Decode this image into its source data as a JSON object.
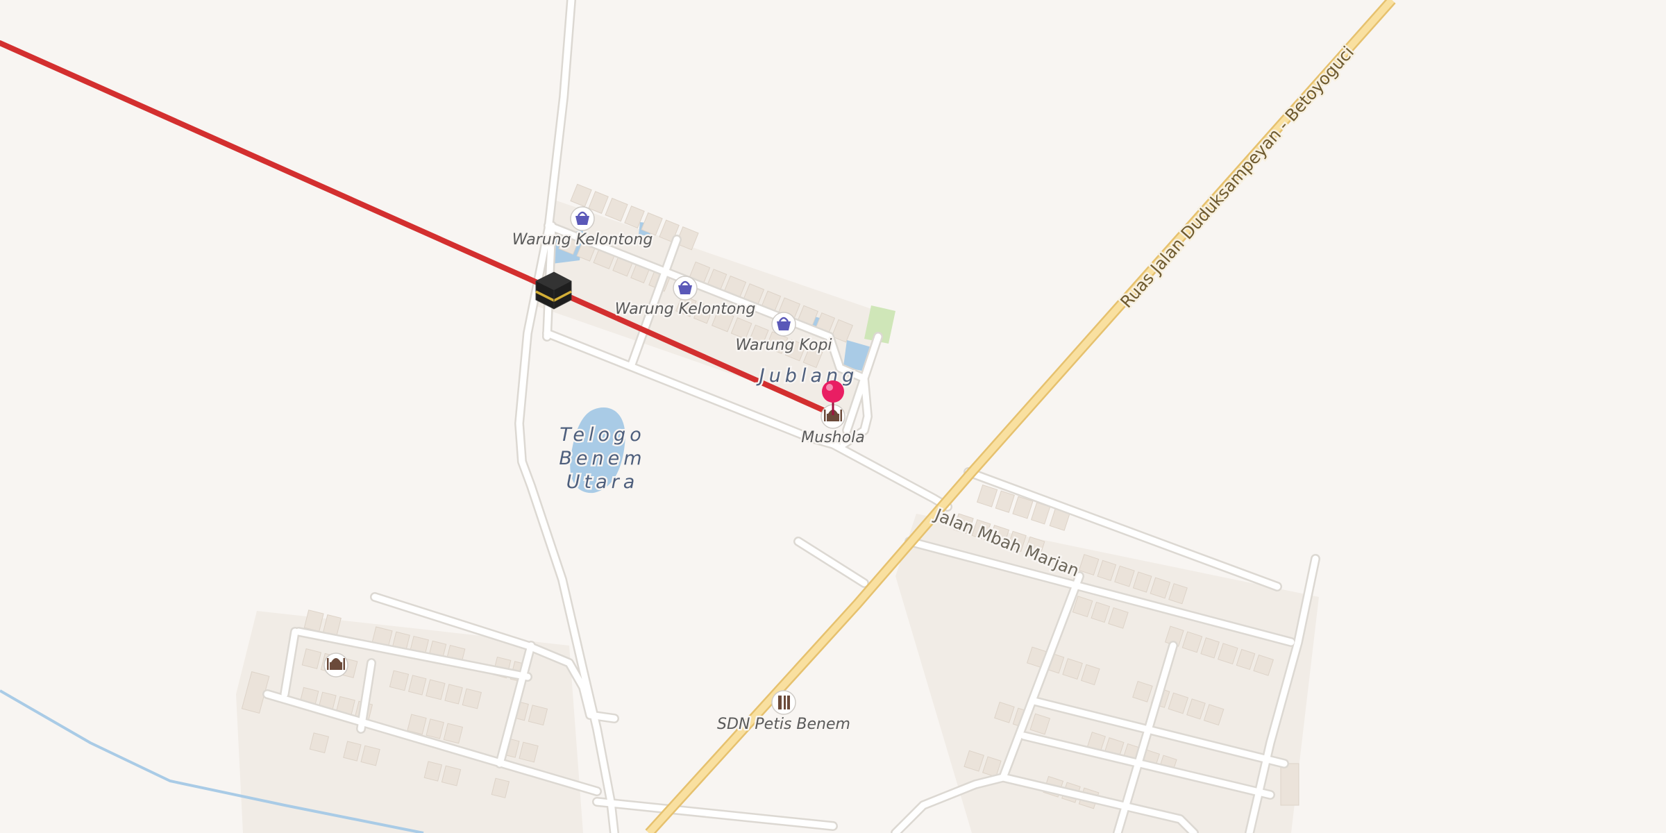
{
  "map": {
    "places": [
      {
        "id": "jublang",
        "lines": [
          "Jublang"
        ]
      },
      {
        "id": "telogo",
        "lines": [
          "Telogo",
          "Benem",
          "Utara"
        ]
      }
    ],
    "pois": [
      {
        "id": "warung-kelontong-1",
        "label": "Warung Kelontong",
        "icon": "shopping-basket-icon"
      },
      {
        "id": "warung-kelontong-2",
        "label": "Warung Kelontong",
        "icon": "shopping-basket-icon"
      },
      {
        "id": "warung-kopi",
        "label": "Warung Kopi",
        "icon": "shopping-basket-icon"
      },
      {
        "id": "mushola",
        "label": "Mushola",
        "icon": "mosque-icon"
      },
      {
        "id": "sdn-petis-benem",
        "label": "SDN Petis Benem",
        "icon": "school-icon"
      },
      {
        "id": "mosque-southwest",
        "label": "",
        "icon": "mosque-icon"
      }
    ],
    "roads": [
      {
        "id": "ruas-jalan",
        "label": "Ruas Jalan Duduksampeyan - Betoyoguci",
        "type": "primary"
      },
      {
        "id": "jalan-mbah-marjan",
        "label": "Jalan Mbah Marjan",
        "type": "residential"
      }
    ],
    "markers": [
      {
        "id": "location-pin",
        "icon": "location-pin-icon",
        "color": "#e91e63"
      },
      {
        "id": "kaaba",
        "icon": "kaaba-icon"
      }
    ],
    "qibla_line_color": "#d32f2f",
    "colors": {
      "background": "#f8f5f2",
      "road": "#ffffff",
      "road_casing": "#dcd8d2",
      "highway": "#f9e0a0",
      "highway_casing": "#e6c16e",
      "water": "#a9cbe6",
      "building": "#ebe3da",
      "park": "#cfe6b8",
      "poi_icon": "#5a58b8"
    }
  }
}
